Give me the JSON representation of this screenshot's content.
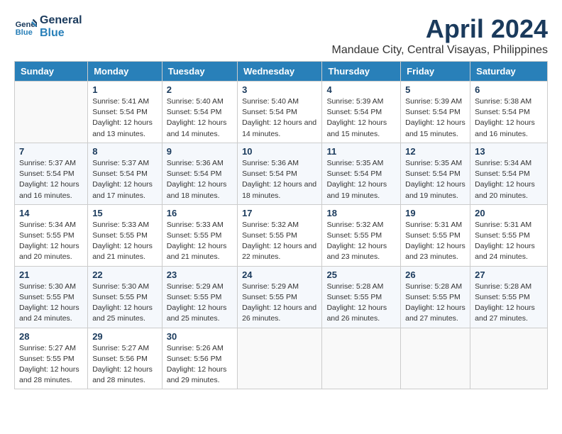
{
  "logo": {
    "line1": "General",
    "line2": "Blue"
  },
  "title": "April 2024",
  "subtitle": "Mandaue City, Central Visayas, Philippines",
  "weekdays": [
    "Sunday",
    "Monday",
    "Tuesday",
    "Wednesday",
    "Thursday",
    "Friday",
    "Saturday"
  ],
  "weeks": [
    [
      {
        "day": "",
        "sunrise": "",
        "sunset": "",
        "daylight": ""
      },
      {
        "day": "1",
        "sunrise": "Sunrise: 5:41 AM",
        "sunset": "Sunset: 5:54 PM",
        "daylight": "Daylight: 12 hours and 13 minutes."
      },
      {
        "day": "2",
        "sunrise": "Sunrise: 5:40 AM",
        "sunset": "Sunset: 5:54 PM",
        "daylight": "Daylight: 12 hours and 14 minutes."
      },
      {
        "day": "3",
        "sunrise": "Sunrise: 5:40 AM",
        "sunset": "Sunset: 5:54 PM",
        "daylight": "Daylight: 12 hours and 14 minutes."
      },
      {
        "day": "4",
        "sunrise": "Sunrise: 5:39 AM",
        "sunset": "Sunset: 5:54 PM",
        "daylight": "Daylight: 12 hours and 15 minutes."
      },
      {
        "day": "5",
        "sunrise": "Sunrise: 5:39 AM",
        "sunset": "Sunset: 5:54 PM",
        "daylight": "Daylight: 12 hours and 15 minutes."
      },
      {
        "day": "6",
        "sunrise": "Sunrise: 5:38 AM",
        "sunset": "Sunset: 5:54 PM",
        "daylight": "Daylight: 12 hours and 16 minutes."
      }
    ],
    [
      {
        "day": "7",
        "sunrise": "Sunrise: 5:37 AM",
        "sunset": "Sunset: 5:54 PM",
        "daylight": "Daylight: 12 hours and 16 minutes."
      },
      {
        "day": "8",
        "sunrise": "Sunrise: 5:37 AM",
        "sunset": "Sunset: 5:54 PM",
        "daylight": "Daylight: 12 hours and 17 minutes."
      },
      {
        "day": "9",
        "sunrise": "Sunrise: 5:36 AM",
        "sunset": "Sunset: 5:54 PM",
        "daylight": "Daylight: 12 hours and 18 minutes."
      },
      {
        "day": "10",
        "sunrise": "Sunrise: 5:36 AM",
        "sunset": "Sunset: 5:54 PM",
        "daylight": "Daylight: 12 hours and 18 minutes."
      },
      {
        "day": "11",
        "sunrise": "Sunrise: 5:35 AM",
        "sunset": "Sunset: 5:54 PM",
        "daylight": "Daylight: 12 hours and 19 minutes."
      },
      {
        "day": "12",
        "sunrise": "Sunrise: 5:35 AM",
        "sunset": "Sunset: 5:54 PM",
        "daylight": "Daylight: 12 hours and 19 minutes."
      },
      {
        "day": "13",
        "sunrise": "Sunrise: 5:34 AM",
        "sunset": "Sunset: 5:54 PM",
        "daylight": "Daylight: 12 hours and 20 minutes."
      }
    ],
    [
      {
        "day": "14",
        "sunrise": "Sunrise: 5:34 AM",
        "sunset": "Sunset: 5:55 PM",
        "daylight": "Daylight: 12 hours and 20 minutes."
      },
      {
        "day": "15",
        "sunrise": "Sunrise: 5:33 AM",
        "sunset": "Sunset: 5:55 PM",
        "daylight": "Daylight: 12 hours and 21 minutes."
      },
      {
        "day": "16",
        "sunrise": "Sunrise: 5:33 AM",
        "sunset": "Sunset: 5:55 PM",
        "daylight": "Daylight: 12 hours and 21 minutes."
      },
      {
        "day": "17",
        "sunrise": "Sunrise: 5:32 AM",
        "sunset": "Sunset: 5:55 PM",
        "daylight": "Daylight: 12 hours and 22 minutes."
      },
      {
        "day": "18",
        "sunrise": "Sunrise: 5:32 AM",
        "sunset": "Sunset: 5:55 PM",
        "daylight": "Daylight: 12 hours and 23 minutes."
      },
      {
        "day": "19",
        "sunrise": "Sunrise: 5:31 AM",
        "sunset": "Sunset: 5:55 PM",
        "daylight": "Daylight: 12 hours and 23 minutes."
      },
      {
        "day": "20",
        "sunrise": "Sunrise: 5:31 AM",
        "sunset": "Sunset: 5:55 PM",
        "daylight": "Daylight: 12 hours and 24 minutes."
      }
    ],
    [
      {
        "day": "21",
        "sunrise": "Sunrise: 5:30 AM",
        "sunset": "Sunset: 5:55 PM",
        "daylight": "Daylight: 12 hours and 24 minutes."
      },
      {
        "day": "22",
        "sunrise": "Sunrise: 5:30 AM",
        "sunset": "Sunset: 5:55 PM",
        "daylight": "Daylight: 12 hours and 25 minutes."
      },
      {
        "day": "23",
        "sunrise": "Sunrise: 5:29 AM",
        "sunset": "Sunset: 5:55 PM",
        "daylight": "Daylight: 12 hours and 25 minutes."
      },
      {
        "day": "24",
        "sunrise": "Sunrise: 5:29 AM",
        "sunset": "Sunset: 5:55 PM",
        "daylight": "Daylight: 12 hours and 26 minutes."
      },
      {
        "day": "25",
        "sunrise": "Sunrise: 5:28 AM",
        "sunset": "Sunset: 5:55 PM",
        "daylight": "Daylight: 12 hours and 26 minutes."
      },
      {
        "day": "26",
        "sunrise": "Sunrise: 5:28 AM",
        "sunset": "Sunset: 5:55 PM",
        "daylight": "Daylight: 12 hours and 27 minutes."
      },
      {
        "day": "27",
        "sunrise": "Sunrise: 5:28 AM",
        "sunset": "Sunset: 5:55 PM",
        "daylight": "Daylight: 12 hours and 27 minutes."
      }
    ],
    [
      {
        "day": "28",
        "sunrise": "Sunrise: 5:27 AM",
        "sunset": "Sunset: 5:55 PM",
        "daylight": "Daylight: 12 hours and 28 minutes."
      },
      {
        "day": "29",
        "sunrise": "Sunrise: 5:27 AM",
        "sunset": "Sunset: 5:56 PM",
        "daylight": "Daylight: 12 hours and 28 minutes."
      },
      {
        "day": "30",
        "sunrise": "Sunrise: 5:26 AM",
        "sunset": "Sunset: 5:56 PM",
        "daylight": "Daylight: 12 hours and 29 minutes."
      },
      {
        "day": "",
        "sunrise": "",
        "sunset": "",
        "daylight": ""
      },
      {
        "day": "",
        "sunrise": "",
        "sunset": "",
        "daylight": ""
      },
      {
        "day": "",
        "sunrise": "",
        "sunset": "",
        "daylight": ""
      },
      {
        "day": "",
        "sunrise": "",
        "sunset": "",
        "daylight": ""
      }
    ]
  ]
}
